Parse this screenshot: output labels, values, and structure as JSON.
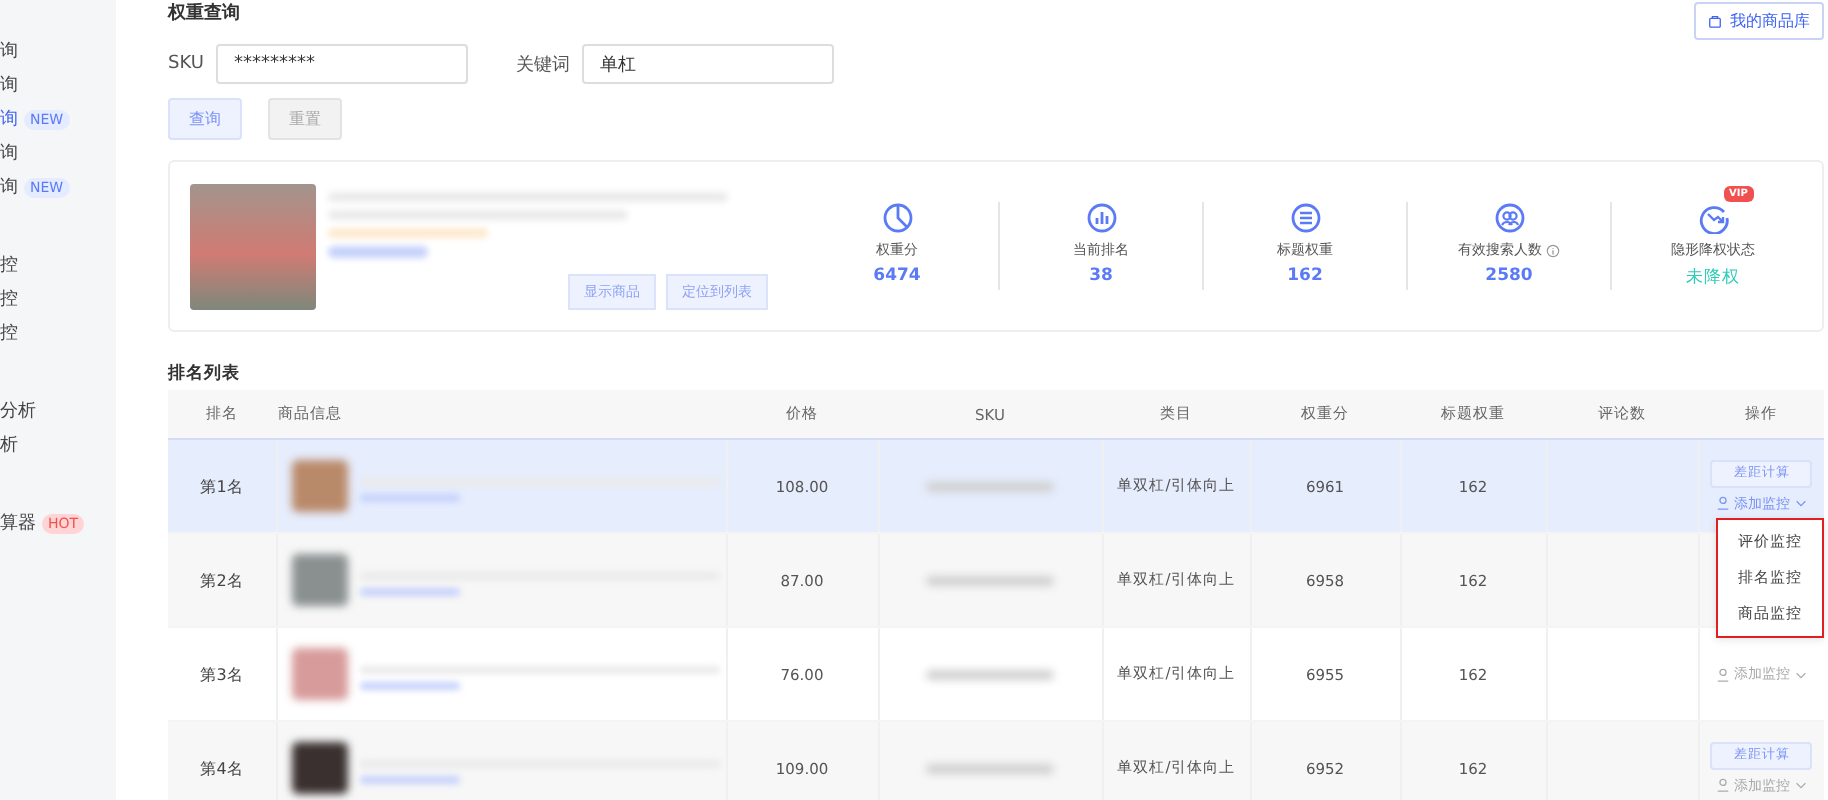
{
  "sidebar": {
    "items": [
      {
        "label": "询",
        "selected": false
      },
      {
        "label": "询",
        "selected": false
      },
      {
        "label": "询",
        "badge": "NEW",
        "selected": true
      },
      {
        "label": "询",
        "selected": false
      },
      {
        "label": "询",
        "badge": "NEW",
        "selected": false
      },
      {
        "label": "控",
        "selected": false
      },
      {
        "label": "控",
        "selected": false
      },
      {
        "label": "控",
        "selected": false
      },
      {
        "label": "分析",
        "selected": false
      },
      {
        "label": "析",
        "selected": false
      },
      {
        "label": "算器",
        "badge": "HOT",
        "selected": false
      }
    ]
  },
  "header": {
    "title": "权重查询",
    "library_button": "我的商品库"
  },
  "search": {
    "sku_label": "SKU",
    "sku_value": "*********",
    "keyword_label": "关键词",
    "keyword_value": "单杠",
    "query_button": "查询",
    "reset_button": "重置"
  },
  "product_card": {
    "buttons": [
      "显示商品",
      "定位到列表"
    ],
    "stats": [
      {
        "label": "权重分",
        "value": "6474",
        "kind": "number"
      },
      {
        "label": "当前排名",
        "value": "38",
        "kind": "number"
      },
      {
        "label": "标题权重",
        "value": "162",
        "kind": "number"
      },
      {
        "label": "有效搜索人数",
        "value": "2580",
        "info": true,
        "kind": "number"
      },
      {
        "label": "隐形降权状态",
        "value": "未降权",
        "vip": "VIP",
        "kind": "status"
      }
    ]
  },
  "ranking": {
    "title": "排名列表",
    "columns": [
      "排名",
      "商品信息",
      "价格",
      "SKU",
      "类目",
      "权重分",
      "标题权重",
      "评论数",
      "操作"
    ],
    "rows": [
      {
        "rank": "第1名",
        "price": "108.00",
        "category": "单双杠/引体向上",
        "weight": "6961",
        "title_weight": "162",
        "highlighted": true,
        "calc_button": "差距计算",
        "monitor_link": "添加监控",
        "expanded": true
      },
      {
        "rank": "第2名",
        "price": "87.00",
        "category": "单双杠/引体向上",
        "weight": "6958",
        "title_weight": "162",
        "highlighted": false
      },
      {
        "rank": "第3名",
        "price": "76.00",
        "category": "单双杠/引体向上",
        "weight": "6955",
        "title_weight": "162",
        "highlighted": false,
        "monitor_link": "添加监控",
        "expanded": false
      },
      {
        "rank": "第4名",
        "price": "109.00",
        "category": "单双杠/引体向上",
        "weight": "6952",
        "title_weight": "162",
        "highlighted": false,
        "calc_button": "差距计算",
        "monitor_link": "添加监控",
        "expanded": false
      }
    ],
    "dropdown": [
      "评价监控",
      "排名监控",
      "商品监控"
    ]
  }
}
